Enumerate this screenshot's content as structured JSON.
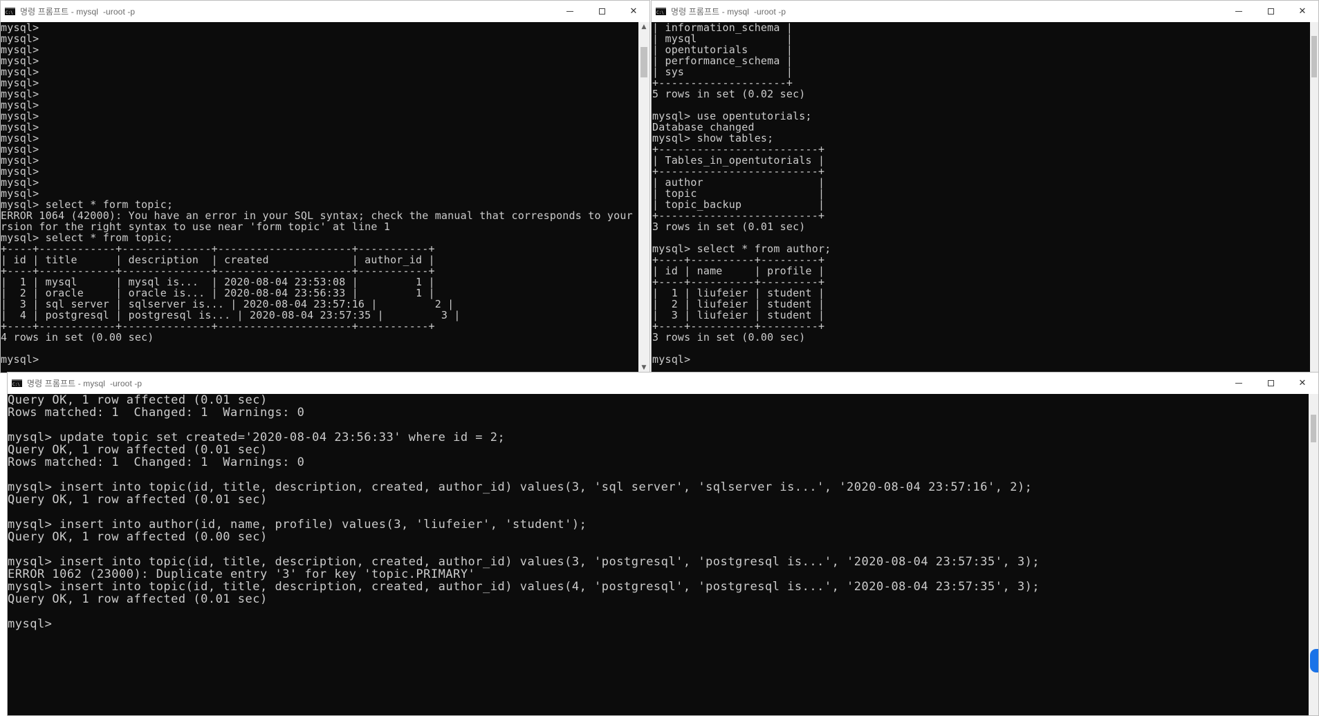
{
  "windows": {
    "top_left": {
      "title": "명령 프롬프트 - mysql  -uroot -p",
      "lines": [
        "mysql>",
        "mysql>",
        "mysql>",
        "mysql>",
        "mysql>",
        "mysql>",
        "mysql>",
        "mysql>",
        "mysql>",
        "mysql>",
        "mysql>",
        "mysql>",
        "mysql>",
        "mysql>",
        "mysql>",
        "mysql>",
        "mysql> select * form topic;",
        "ERROR 1064 (42000): You have an error in your SQL syntax; check the manual that corresponds to your MySQL server ve",
        "rsion for the right syntax to use near 'form topic' at line 1",
        "mysql> select * from topic;",
        "+----+------------+--------------+---------------------+-----------+",
        "| id | title      | description  | created             | author_id |",
        "+----+------------+--------------+---------------------+-----------+",
        "|  1 | mysql      | mysql is...  | 2020-08-04 23:53:08 |         1 |",
        "|  2 | oracle     | oracle is... | 2020-08-04 23:56:33 |         1 |",
        "|  3 | sql server | sqlserver is... | 2020-08-04 23:57:16 |         2 |",
        "|  4 | postgresql | postgresql is... | 2020-08-04 23:57:35 |         3 |",
        "+----+------------+--------------+---------------------+-----------+",
        "4 rows in set (0.00 sec)",
        "",
        "mysql>"
      ]
    },
    "top_right": {
      "title": "명령 프롬프트 - mysql  -uroot -p",
      "lines": [
        "| information_schema |",
        "| mysql              |",
        "| opentutorials      |",
        "| performance_schema |",
        "| sys                |",
        "+--------------------+",
        "5 rows in set (0.02 sec)",
        "",
        "mysql> use opentutorials;",
        "Database changed",
        "mysql> show tables;",
        "+-------------------------+",
        "| Tables_in_opentutorials |",
        "+-------------------------+",
        "| author                  |",
        "| topic                   |",
        "| topic_backup            |",
        "+-------------------------+",
        "3 rows in set (0.01 sec)",
        "",
        "mysql> select * from author;",
        "+----+----------+---------+",
        "| id | name     | profile |",
        "+----+----------+---------+",
        "|  1 | liufeier | student |",
        "|  2 | liufeier | student |",
        "|  3 | liufeier | student |",
        "+----+----------+---------+",
        "3 rows in set (0.00 sec)",
        "",
        "mysql>"
      ]
    },
    "bottom": {
      "title": "명령 프롬프트 - mysql  -uroot -p",
      "lines": [
        "Query OK, 1 row affected (0.01 sec)",
        "Rows matched: 1  Changed: 1  Warnings: 0",
        "",
        "mysql> update topic set created='2020-08-04 23:56:33' where id = 2;",
        "Query OK, 1 row affected (0.01 sec)",
        "Rows matched: 1  Changed: 1  Warnings: 0",
        "",
        "mysql> insert into topic(id, title, description, created, author_id) values(3, 'sql server', 'sqlserver is...', '2020-08-04 23:57:16', 2);",
        "Query OK, 1 row affected (0.01 sec)",
        "",
        "mysql> insert into author(id, name, profile) values(3, 'liufeier', 'student');",
        "Query OK, 1 row affected (0.00 sec)",
        "",
        "mysql> insert into topic(id, title, description, created, author_id) values(3, 'postgresql', 'postgresql is...', '2020-08-04 23:57:35', 3);",
        "ERROR 1062 (23000): Duplicate entry '3' for key 'topic.PRIMARY'",
        "mysql> insert into topic(id, title, description, created, author_id) values(4, 'postgresql', 'postgresql is...', '2020-08-04 23:57:35', 3);",
        "Query OK, 1 row affected (0.01 sec)",
        "",
        "mysql>"
      ]
    }
  },
  "controls": {
    "minimize": "─",
    "maximize": "□",
    "close": "✕"
  },
  "icons": {
    "app": "cmd-icon",
    "scroll_up": "▲",
    "scroll_down": "▼"
  },
  "colors": {
    "console_bg": "#0c0c0c",
    "console_text": "#cccccc",
    "titlebar_bg": "#ffffff",
    "accent": "#1a73e8"
  }
}
